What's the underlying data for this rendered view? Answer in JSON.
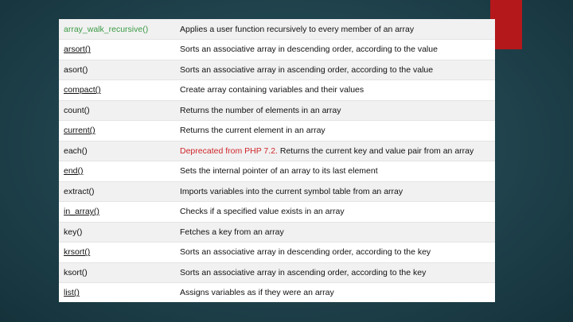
{
  "colors": {
    "background": "#224650",
    "accent": "#b5181b",
    "green_text": "#3a9a45",
    "deprecated_text": "#d0262a"
  },
  "rows": [
    {
      "fn": "array_walk_recursive()",
      "desc": "Applies a user function recursively to every member of an array",
      "style": "green"
    },
    {
      "fn": "arsort()",
      "desc": "Sorts an associative array in descending order, according to the value",
      "style": "link"
    },
    {
      "fn": "asort()",
      "desc": "Sorts an associative array in ascending order, according to the value",
      "style": "plain"
    },
    {
      "fn": "compact()",
      "desc": "Create array containing variables and their values",
      "style": "link"
    },
    {
      "fn": "count()",
      "desc": "Returns the number of elements in an array",
      "style": "plain"
    },
    {
      "fn": "current()",
      "desc": "Returns the current element in an array",
      "style": "link"
    },
    {
      "fn": "each()",
      "desc_deprecated": "Deprecated from PHP 7.2.",
      "desc": " Returns the current key and value pair from an array",
      "style": "plain"
    },
    {
      "fn": "end()",
      "desc": "Sets the internal pointer of an array to its last element",
      "style": "link"
    },
    {
      "fn": "extract()",
      "desc": "Imports variables into the current symbol table from an array",
      "style": "plain"
    },
    {
      "fn": "in_array()",
      "desc": "Checks if a specified value exists in an array",
      "style": "link"
    },
    {
      "fn": "key()",
      "desc": "Fetches a key from an array",
      "style": "plain"
    },
    {
      "fn": "krsort()",
      "desc": "Sorts an associative array in descending order, according to the key",
      "style": "link"
    },
    {
      "fn": "ksort()",
      "desc": "Sorts an associative array in ascending order, according to the key",
      "style": "plain"
    },
    {
      "fn": "list()",
      "desc": "Assigns variables as if they were an array",
      "style": "link"
    }
  ]
}
